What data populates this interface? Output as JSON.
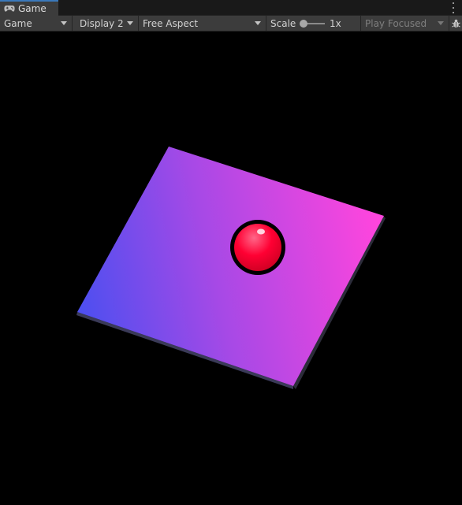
{
  "window": {
    "tab_label": "Game",
    "tab_icon": "gamepad-icon",
    "menu_icon": "kebab-menu-icon"
  },
  "toolbar": {
    "view_mode": "Game",
    "display": "Display 2",
    "aspect": "Free Aspect",
    "scale_label": "Scale",
    "scale_value": "1x",
    "scale_level": 0,
    "play_mode": "Play Focused",
    "debug_icon": "bug-icon"
  },
  "scene": {
    "plane_colors": [
      "#4b4ff0",
      "#a649e6",
      "#ff45dd"
    ],
    "ball_color": "#ff0033",
    "ball_outline_color": "#000000",
    "background_color": "#000000"
  }
}
